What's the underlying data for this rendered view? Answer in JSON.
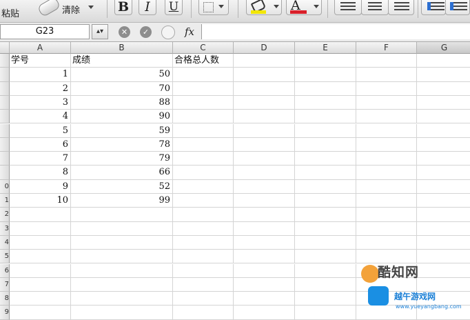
{
  "toolbar": {
    "paste_label": "粘贴",
    "clear_label": "清除",
    "bold_label": "B",
    "italic_label": "I",
    "underline_label": "U",
    "font_color_label": "A",
    "fill_color": "#f2e600",
    "font_color": "#d9202a"
  },
  "formula_bar": {
    "cell_ref": "G23",
    "fx_label": "fx",
    "formula_value": ""
  },
  "sheet": {
    "columns": [
      "A",
      "B",
      "C",
      "D",
      "E",
      "F",
      "G"
    ],
    "header_row": [
      "学号",
      "成绩",
      "合格总人数"
    ],
    "rows": [
      {
        "id": "1",
        "score": "50"
      },
      {
        "id": "2",
        "score": "70"
      },
      {
        "id": "3",
        "score": "88"
      },
      {
        "id": "4",
        "score": "90"
      },
      {
        "id": "5",
        "score": "59"
      },
      {
        "id": "6",
        "score": "78"
      },
      {
        "id": "7",
        "score": "79"
      },
      {
        "id": "8",
        "score": "66"
      },
      {
        "id": "9",
        "score": "52"
      },
      {
        "id": "10",
        "score": "99"
      }
    ],
    "row_numbers": [
      "",
      "",
      "",
      "",
      "",
      "",
      "",
      "",
      "",
      "0",
      "1",
      "2",
      "3",
      "4",
      "5",
      "6",
      "7",
      "8",
      "9"
    ]
  },
  "watermark": {
    "brand": "酷知网",
    "site_name": "越午游戏网",
    "site_url": "www.yueyangbang.com"
  }
}
